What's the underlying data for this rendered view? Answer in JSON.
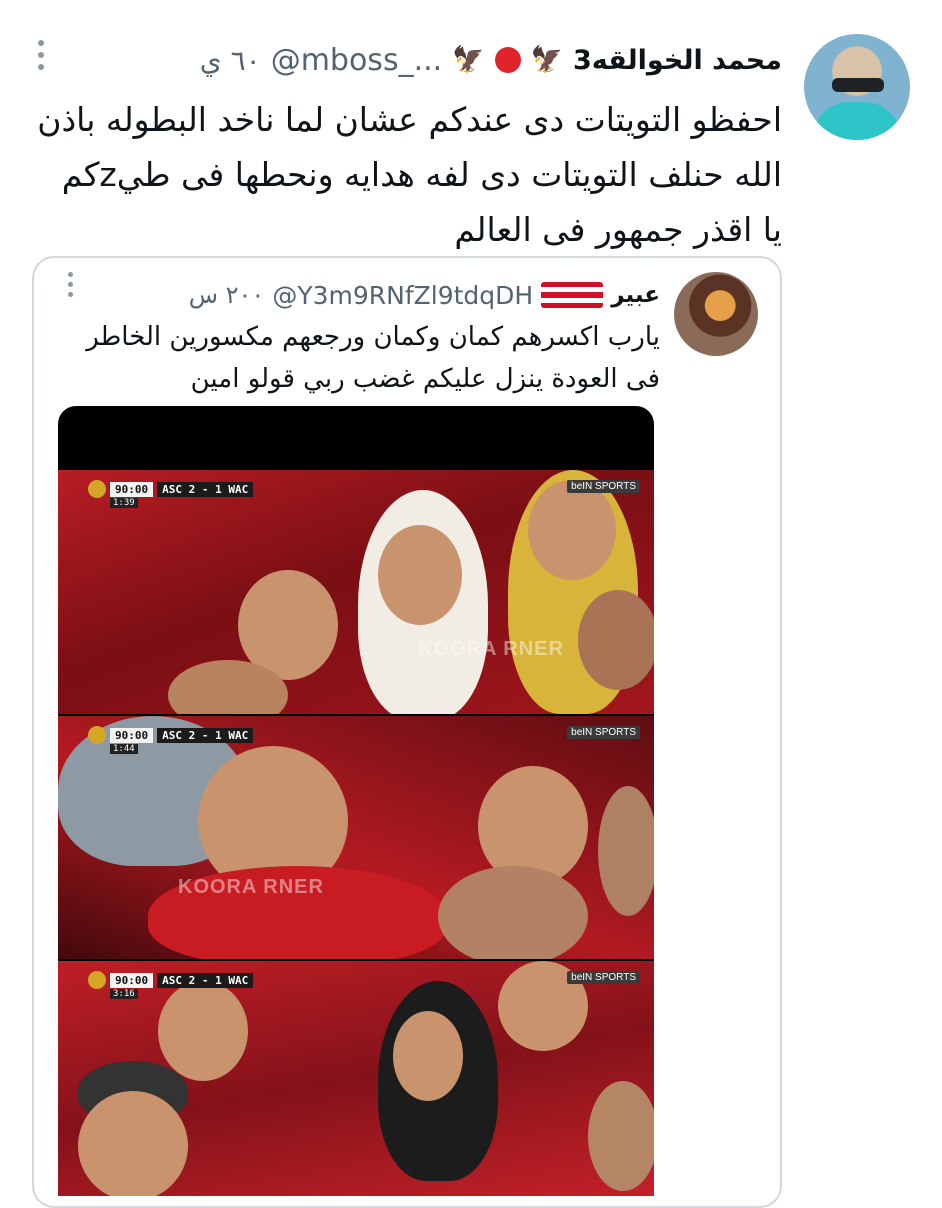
{
  "tweet": {
    "display_name": "محمد الخوالقه3",
    "name_emojis": [
      "🦅",
      "🦅"
    ],
    "handle": "@mboss_...",
    "time": "٦٠ ي",
    "text": "احفظو التويتات دى عندكم عشان لما ناخد البطوله باذن\nالله حنلف التويتات دى لفه هدايه ونحطها فى طيzكم\nيا اقذر جمهور فى العالم"
  },
  "quoted": {
    "display_name": "عبير",
    "handle": "@Y3m9RNfZl9tdqDH",
    "time": "٢٠٠ س",
    "flag_colors": [
      "#ce1126",
      "#ffffff",
      "#ce1126",
      "#ffffff",
      "#ce1126"
    ],
    "text": "يارب اكسرهم كمان وكمان ورجعهم مكسورين الخاطر\nفى العودة ينزل عليكم غضب ربي قولو امين",
    "media": {
      "frames": [
        {
          "clock": "90:00",
          "score": "ASC 2 - 1 WAC",
          "added": "1:39",
          "watermark": "KOORA RNER",
          "channel": "beIN SPORTS"
        },
        {
          "clock": "90:00",
          "score": "ASC 2 - 1 WAC",
          "added": "1:44",
          "watermark": "KOORA RNER",
          "channel": "beIN SPORTS"
        },
        {
          "clock": "90:00",
          "score": "ASC 2 - 1 WAC",
          "added": "3:16",
          "watermark": "",
          "channel": "beIN SPORTS"
        }
      ]
    }
  },
  "colors": {
    "accent_red": "#e0242c",
    "secondary_text": "#536471",
    "border": "#cfd9de"
  }
}
